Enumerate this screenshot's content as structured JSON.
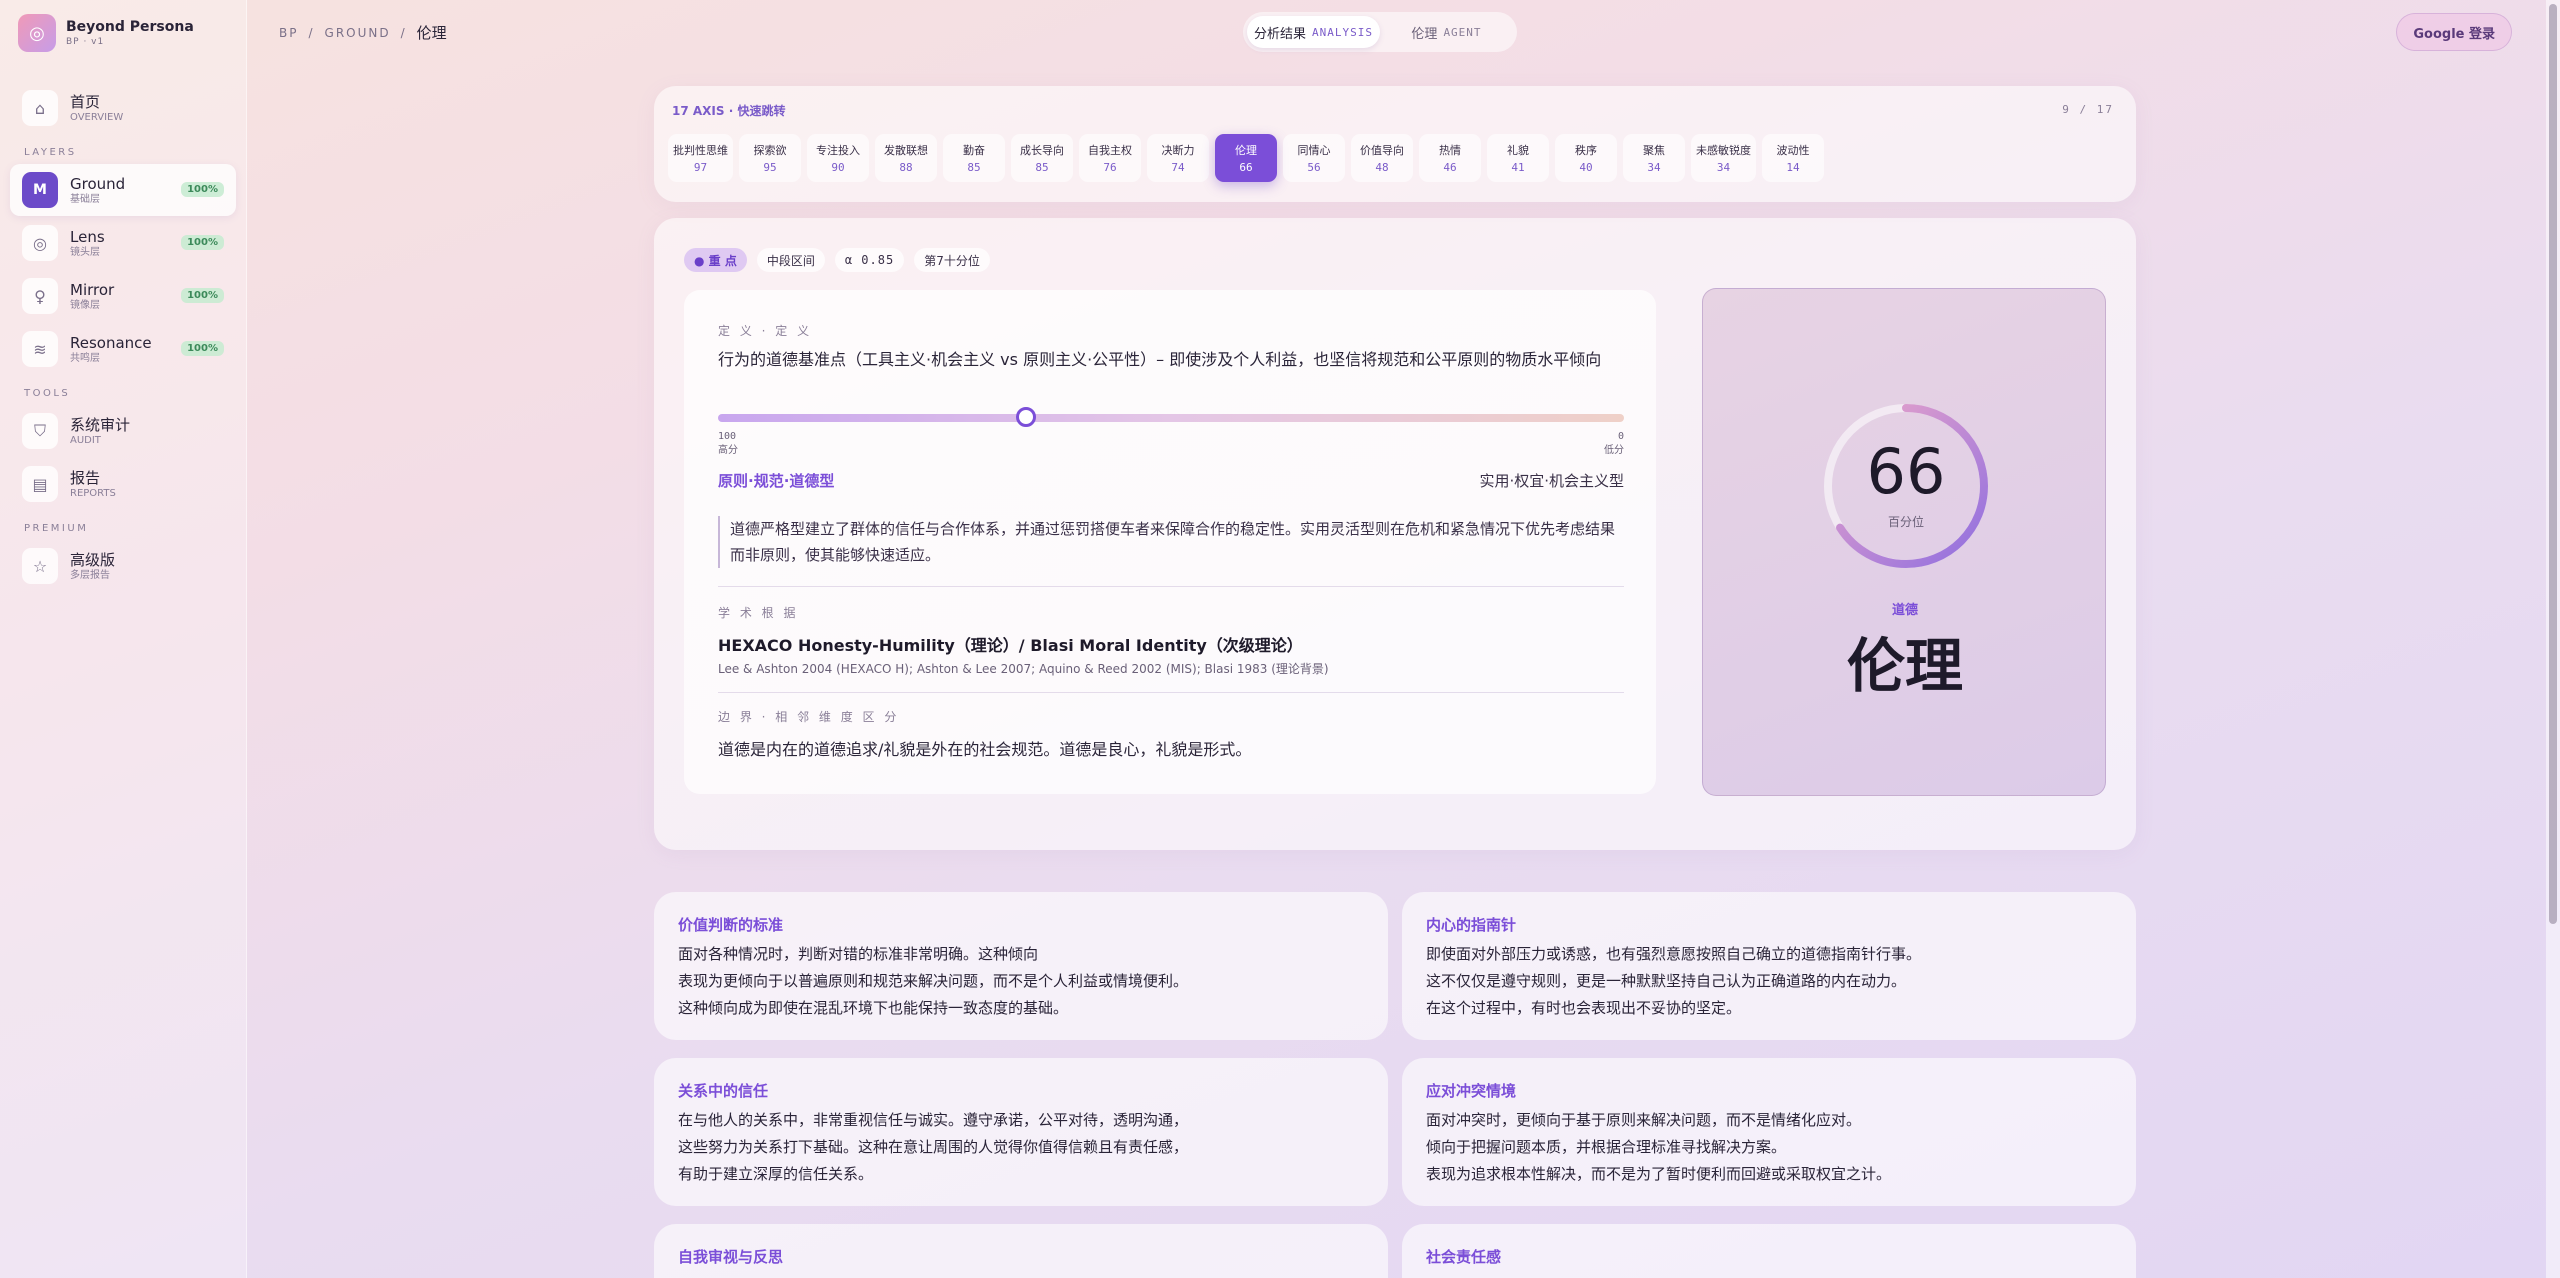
{
  "brand": {
    "name": "Beyond Persona",
    "sub": "BP · v1"
  },
  "sidebar": {
    "overview": {
      "label": "首页",
      "sub": "OVERVIEW"
    },
    "layers_title": "LAYERS",
    "layers": [
      {
        "label": "Ground",
        "sub": "基础层",
        "badge": "100%",
        "icon": "M"
      },
      {
        "label": "Lens",
        "sub": "镜头层",
        "badge": "100%"
      },
      {
        "label": "Mirror",
        "sub": "镜像层",
        "badge": "100%"
      },
      {
        "label": "Resonance",
        "sub": "共鸣层",
        "badge": "100%"
      }
    ],
    "tools_title": "TOOLS",
    "tools": [
      {
        "label": "系统审计",
        "sub": "AUDIT"
      },
      {
        "label": "报告",
        "sub": "REPORTS"
      }
    ],
    "premium_title": "PREMIUM",
    "premium": {
      "label": "高级版",
      "sub": "多层报告"
    }
  },
  "breadcrumb": {
    "root": "BP",
    "section": "GROUND",
    "current": "伦理"
  },
  "toggle": {
    "analysis": {
      "label": "分析结果",
      "en": "ANALYSIS"
    },
    "agent": {
      "label": "伦理",
      "en": "AGENT"
    }
  },
  "google_btn": "Google 登录",
  "axis_panel": {
    "title": "17 AXIS · 快速跳转",
    "count": "9 / 17",
    "items": [
      {
        "name": "批判性思维",
        "value": "97"
      },
      {
        "name": "探索欲",
        "value": "95"
      },
      {
        "name": "专注投入",
        "value": "90"
      },
      {
        "name": "发散联想",
        "value": "88"
      },
      {
        "name": "勤奋",
        "value": "85"
      },
      {
        "name": "成长导向",
        "value": "85"
      },
      {
        "name": "自我主权",
        "value": "76"
      },
      {
        "name": "决断力",
        "value": "74"
      },
      {
        "name": "伦理",
        "value": "66"
      },
      {
        "name": "同情心",
        "value": "56"
      },
      {
        "name": "价值导向",
        "value": "48"
      },
      {
        "name": "热情",
        "value": "46"
      },
      {
        "name": "礼貌",
        "value": "41"
      },
      {
        "name": "秩序",
        "value": "40"
      },
      {
        "name": "聚焦",
        "value": "34"
      },
      {
        "name": "未感敏锐度",
        "value": "34"
      },
      {
        "name": "波动性",
        "value": "14"
      }
    ]
  },
  "chips": {
    "primary": "● 重 点",
    "band": "中段区间",
    "alpha": "α 0.85",
    "pct": "第7十分位"
  },
  "detail": {
    "def_label": "定 义 · 定 义",
    "def_text": "行为的道德基准点（工具主义·机会主义 vs 原则主义·公平性）– 即使涉及个人利益，也坚信将规范和公平原则的物质水平倾向",
    "slider": {
      "position": 0.34,
      "left_num": "100",
      "left_lbl": "高分",
      "right_num": "0",
      "right_lbl": "低分"
    },
    "pole_left": "原则·规范·道德型",
    "pole_right": "实用·权宜·机会主义型",
    "quote": "道德严格型建立了群体的信任与合作体系，并通过惩罚搭便车者来保障合作的稳定性。实用灵活型则在危机和紧急情况下优先考虑结果而非原则，使其能够快速适应。",
    "theory_label": "学 术 根 据",
    "theory_title": "HEXACO Honesty-Humility（理论）/ Blasi Moral Identity（次级理论）",
    "theory_cite": "Lee & Ashton 2004 (HEXACO H); Ashton & Lee 2007; Aquino & Reed 2002 (MIS); Blasi 1983 (理论背景)",
    "bound_label": "边 界 · 相 邻 维 度 区 分",
    "bound_text": "道德是内在的道德追求/礼貌是外在的社会规范。道德是良心，礼貌是形式。"
  },
  "score": {
    "value": "66",
    "value_fraction": 0.66,
    "sub": "百分位",
    "category": "道德",
    "name": "伦理"
  },
  "insights": [
    {
      "title": "价值判断的标准",
      "lines": [
        "面对各种情况时，判断对错的标准非常明确。这种倾向",
        "表现为更倾向于以普遍原则和规范来解决问题，而不是个人利益或情境便利。",
        "这种倾向成为即使在混乱环境下也能保持一致态度的基础。"
      ]
    },
    {
      "title": "内心的指南针",
      "lines": [
        "即使面对外部压力或诱惑，也有强烈意愿按照自己确立的道德指南针行事。",
        "这不仅仅是遵守规则，更是一种默默坚持自己认为正确道路的内在动力。",
        "在这个过程中，有时也会表现出不妥协的坚定。"
      ]
    },
    {
      "title": "关系中的信任",
      "lines": [
        "在与他人的关系中，非常重视信任与诚实。遵守承诺，公平对待，透明沟通，",
        "这些努力为关系打下基础。这种在意让周围的人觉得你值得信赖且有责任感，",
        "有助于建立深厚的信任关系。"
      ]
    },
    {
      "title": "应对冲突情境",
      "lines": [
        "面对冲突时，更倾向于基于原则来解决问题，而不是情绪化应对。",
        "倾向于把握问题本质，并根据合理标准寻找解决方案。",
        "表现为追求根本性解决，而不是为了暂时便利而回避或采取权宜之计。"
      ]
    },
    {
      "title": "自我审视与反思",
      "lines": []
    },
    {
      "title": "社会责任感",
      "lines": []
    }
  ],
  "colors": {
    "accent": "#7b4ed8",
    "ring_start": "#8f6ee0",
    "ring_end": "#f0a8c8"
  }
}
